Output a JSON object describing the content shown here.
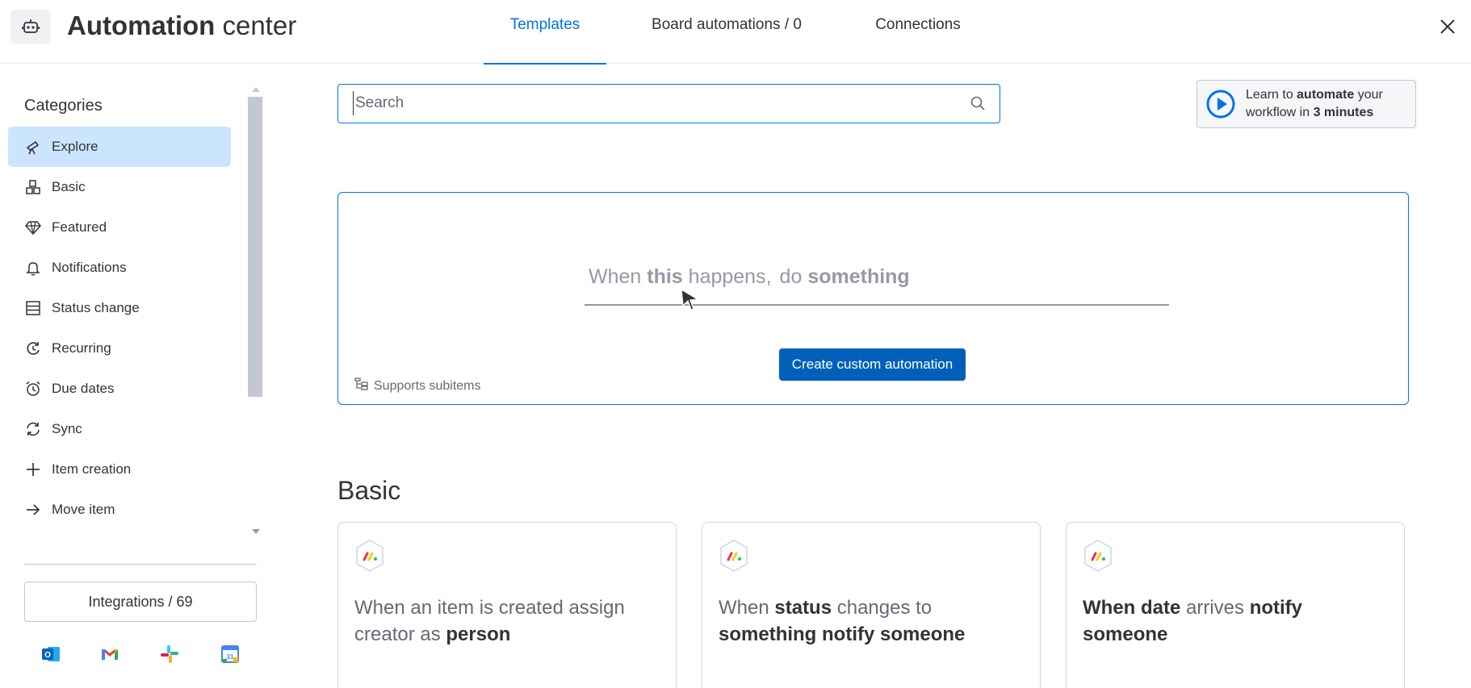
{
  "header": {
    "title_bold": "Automation",
    "title_light": " center",
    "tabs": [
      {
        "label": "Templates",
        "active": true
      },
      {
        "label": "Board automations / 0",
        "active": false
      },
      {
        "label": "Connections",
        "active": false
      }
    ],
    "icons": {
      "app": "robot-icon",
      "close": "close-icon"
    }
  },
  "sidebar": {
    "heading": "Categories",
    "items": [
      {
        "label": "Explore",
        "icon": "telescope-icon",
        "active": true
      },
      {
        "label": "Basic",
        "icon": "blocks-icon"
      },
      {
        "label": "Featured",
        "icon": "diamond-icon"
      },
      {
        "label": "Notifications",
        "icon": "bell-icon"
      },
      {
        "label": "Status change",
        "icon": "status-rows-icon"
      },
      {
        "label": "Recurring",
        "icon": "recurring-icon"
      },
      {
        "label": "Due dates",
        "icon": "alarm-clock-icon"
      },
      {
        "label": "Sync",
        "icon": "sync-icon"
      },
      {
        "label": "Item creation",
        "icon": "plus-icon"
      },
      {
        "label": "Move item",
        "icon": "arrow-right-icon"
      }
    ],
    "integrations_label": "Integrations / 69",
    "integration_icons": [
      "outlook-icon",
      "gmail-icon",
      "slack-icon",
      "google-calendar-icon"
    ]
  },
  "search": {
    "placeholder": "Search",
    "value": ""
  },
  "learn": {
    "text_1": "Learn to ",
    "text_bold_1": "automate",
    "text_2": " your",
    "text_3": "workflow in ",
    "text_bold_2": "3 minutes"
  },
  "custom": {
    "w1": "When ",
    "w2": "this",
    "w3": " happens,",
    "w4": "do ",
    "w5": "something",
    "button_label": "Create custom automation",
    "subitems_label": "Supports subitems"
  },
  "section": {
    "title": "Basic"
  },
  "templates": [
    {
      "parts": [
        {
          "t": "When an item is created assign creator as ",
          "b": false
        },
        {
          "t": "person",
          "b": true
        }
      ]
    },
    {
      "parts": [
        {
          "t": "When ",
          "b": false
        },
        {
          "t": "status",
          "b": true
        },
        {
          "t": " changes to ",
          "b": false
        },
        {
          "t": "something",
          "b": true
        },
        {
          "t": " ",
          "b": false
        },
        {
          "t": "notify",
          "b": true
        },
        {
          "t": " ",
          "b": false
        },
        {
          "t": "someone",
          "b": true
        }
      ]
    },
    {
      "parts": [
        {
          "t": "When date",
          "b": true
        },
        {
          "t": " arrives ",
          "b": false
        },
        {
          "t": "notify",
          "b": true
        },
        {
          "t": " someone",
          "b": true
        }
      ]
    }
  ],
  "colors": {
    "accent": "#0073ea",
    "button": "#0060b9",
    "active_bg": "#cce5ff"
  }
}
